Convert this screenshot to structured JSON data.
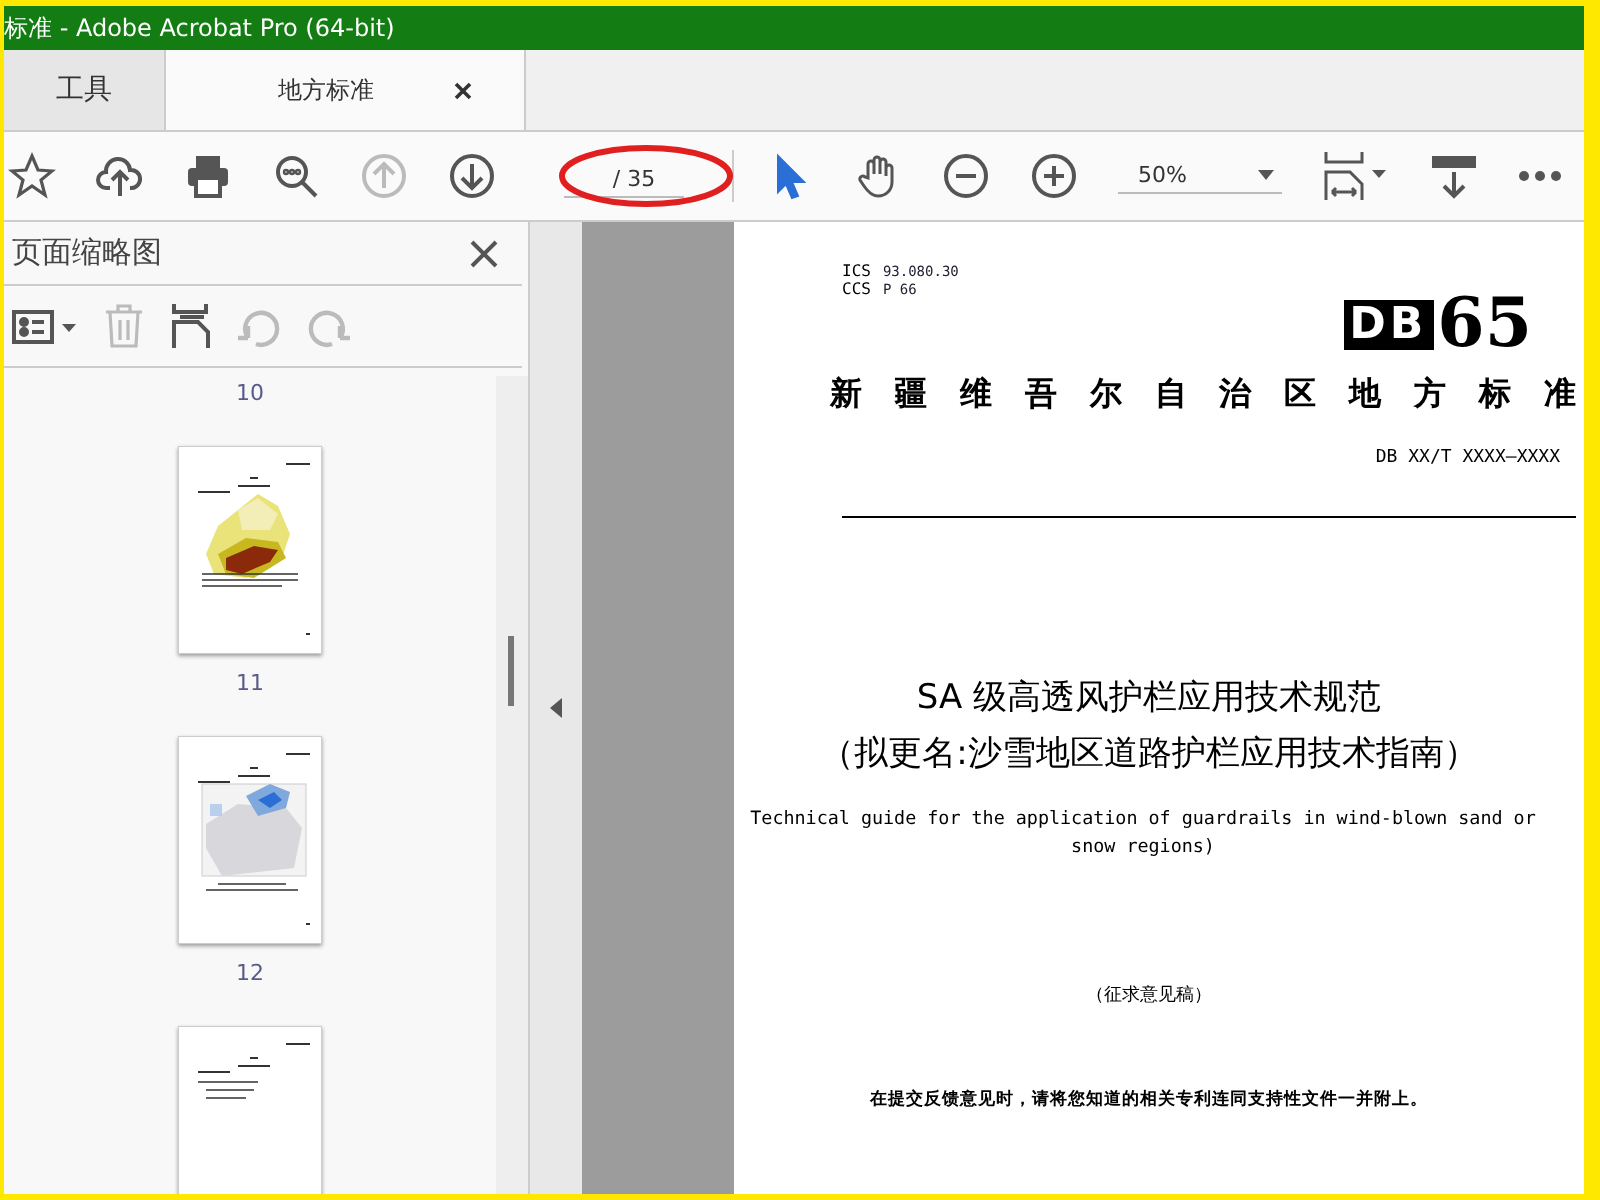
{
  "window": {
    "title": "标准 - Adobe Acrobat Pro (64-bit)"
  },
  "tabs": [
    {
      "label": "工具",
      "selected": false,
      "closable": false
    },
    {
      "label": "地方标准",
      "selected": true,
      "closable": true
    }
  ],
  "toolbar": {
    "left_tools": [
      {
        "kind": "star",
        "disabled": false
      },
      {
        "kind": "upload",
        "disabled": false
      },
      {
        "kind": "print",
        "disabled": false
      },
      {
        "kind": "search",
        "disabled": false
      },
      {
        "kind": "prev",
        "disabled": true
      },
      {
        "kind": "next",
        "disabled": false
      }
    ],
    "page_total": "/ 35",
    "right_tools": [
      {
        "kind": "pointer",
        "selected": true
      },
      {
        "kind": "hand",
        "selected": false
      },
      {
        "kind": "zoom-out",
        "selected": false
      },
      {
        "kind": "zoom-in",
        "selected": false
      }
    ],
    "zoom": "50%"
  },
  "thumbnail_panel": {
    "title": "页面缩略图",
    "tools": [
      {
        "kind": "options",
        "disabled": false
      },
      {
        "kind": "delete",
        "disabled": true
      },
      {
        "kind": "insert",
        "disabled": false
      },
      {
        "kind": "rotate-left",
        "disabled": true
      },
      {
        "kind": "rotate-right",
        "disabled": true
      }
    ],
    "top_label": "10",
    "thumbnails": [
      {
        "kind": "heat-map",
        "label": "11"
      },
      {
        "kind": "blue-map",
        "label": "12"
      },
      {
        "kind": "text"
      }
    ]
  },
  "document": {
    "ics_label": "ICS",
    "ics": "93.080.30",
    "ccs_label": "CCS",
    "ccs": "P 66",
    "logo_letters": "DB",
    "logo_number": "65",
    "issuer": "新疆维吾尔自治区地方标准",
    "code": "DB XX/T XXXX—XXXX",
    "title_lines": [
      "SA 级高透风护栏应用技术规范",
      "（拟更名:沙雪地区道路护栏应用技术指南）"
    ],
    "english_title": "Technical guide for the application of guardrails in wind-blown sand or snow regions)",
    "draft": "（征求意见稿）",
    "note": "在提交反馈意见时，请将您知道的相关专利连同支持性文件一并附上。"
  }
}
